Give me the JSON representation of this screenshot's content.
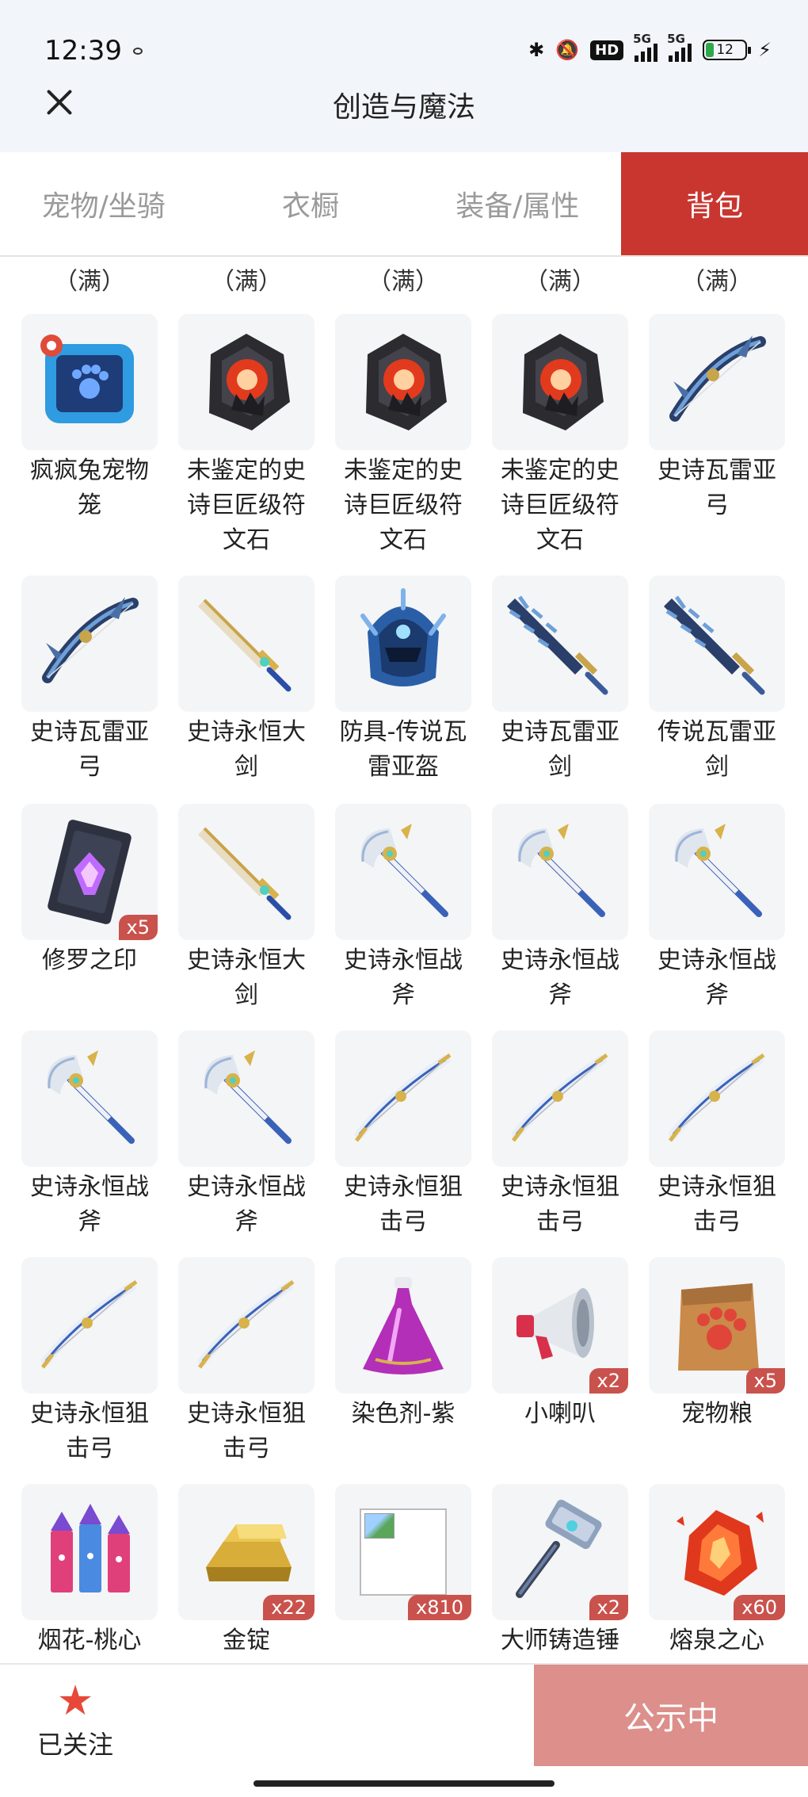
{
  "status_bar": {
    "time": "12:39",
    "hd": "HD",
    "net1": "5G",
    "net2": "5G",
    "battery": "12"
  },
  "header": {
    "title": "创造与魔法"
  },
  "tabs": [
    {
      "label": "宠物/坐骑",
      "active": false
    },
    {
      "label": "衣橱",
      "active": false
    },
    {
      "label": "装备/属性",
      "active": false
    },
    {
      "label": "背包",
      "active": true
    }
  ],
  "top_labels": [
    "（满）",
    "（满）",
    "（满）",
    "（满）",
    "（满）"
  ],
  "items": [
    {
      "name": "疯疯兔宠物笼",
      "badge": "",
      "icon": "pet-cage"
    },
    {
      "name": "未鉴定的史诗巨匠级符文石",
      "badge": "",
      "icon": "rune-stone"
    },
    {
      "name": "未鉴定的史诗巨匠级符文石",
      "badge": "",
      "icon": "rune-stone"
    },
    {
      "name": "未鉴定的史诗巨匠级符文石",
      "badge": "",
      "icon": "rune-stone"
    },
    {
      "name": "史诗瓦雷亚弓",
      "badge": "",
      "icon": "dark-bow"
    },
    {
      "name": "史诗瓦雷亚弓",
      "badge": "",
      "icon": "dark-bow"
    },
    {
      "name": "史诗永恒大剑",
      "badge": "",
      "icon": "gold-sword"
    },
    {
      "name": "防具-传说瓦雷亚盔",
      "badge": "",
      "icon": "helmet"
    },
    {
      "name": "史诗瓦雷亚剑",
      "badge": "",
      "icon": "dark-sword"
    },
    {
      "name": "传说瓦雷亚剑",
      "badge": "",
      "icon": "dark-sword"
    },
    {
      "name": "修罗之印",
      "badge": "x5",
      "icon": "seal-card"
    },
    {
      "name": "史诗永恒大剑",
      "badge": "",
      "icon": "gold-sword"
    },
    {
      "name": "史诗永恒战斧",
      "badge": "",
      "icon": "axe"
    },
    {
      "name": "史诗永恒战斧",
      "badge": "",
      "icon": "axe"
    },
    {
      "name": "史诗永恒战斧",
      "badge": "",
      "icon": "axe"
    },
    {
      "name": "史诗永恒战斧",
      "badge": "",
      "icon": "axe"
    },
    {
      "name": "史诗永恒战斧",
      "badge": "",
      "icon": "axe"
    },
    {
      "name": "史诗永恒狙击弓",
      "badge": "",
      "icon": "white-bow"
    },
    {
      "name": "史诗永恒狙击弓",
      "badge": "",
      "icon": "white-bow"
    },
    {
      "name": "史诗永恒狙击弓",
      "badge": "",
      "icon": "white-bow"
    },
    {
      "name": "史诗永恒狙击弓",
      "badge": "",
      "icon": "white-bow"
    },
    {
      "name": "史诗永恒狙击弓",
      "badge": "",
      "icon": "white-bow"
    },
    {
      "name": "染色剂-紫",
      "badge": "",
      "icon": "purple-potion"
    },
    {
      "name": "小喇叭",
      "badge": "x2",
      "icon": "megaphone"
    },
    {
      "name": "宠物粮",
      "badge": "x5",
      "icon": "pet-food"
    },
    {
      "name": "烟花-桃心",
      "badge": "",
      "icon": "fireworks"
    },
    {
      "name": "金锭",
      "badge": "x22",
      "icon": "gold-ingot"
    },
    {
      "name": "",
      "badge": "x810",
      "icon": "broken-image"
    },
    {
      "name": "大师铸造锤",
      "badge": "x2",
      "icon": "hammer"
    },
    {
      "name": "熔泉之心",
      "badge": "x60",
      "icon": "lava-crystal"
    }
  ],
  "bottom": {
    "follow_label": "已关注",
    "cta_label": "公示中"
  },
  "colors": {
    "accent": "#c8362f",
    "cta": "#dc8f8b",
    "badge": "#c9524d",
    "star": "#e8483a"
  }
}
